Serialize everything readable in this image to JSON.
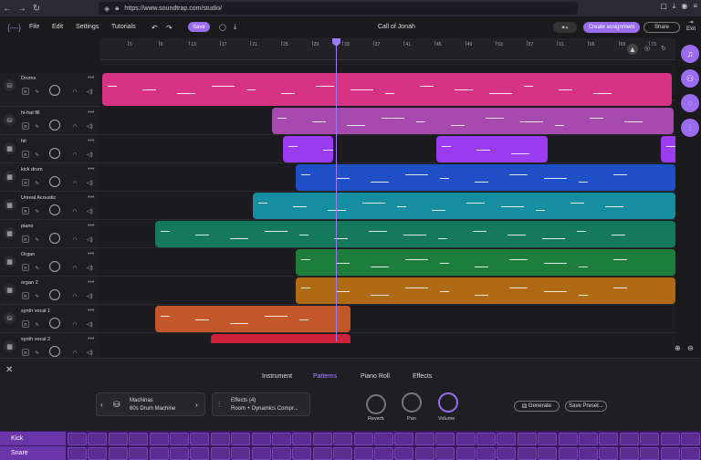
{
  "browser": {
    "url": "https://www.soundtrap.com/studio/"
  },
  "topbar": {
    "menu": [
      "File",
      "Edit",
      "Settings",
      "Tutorials"
    ],
    "save_label": "Save",
    "project_title": "Call of Jonah",
    "create_assignment": "Create assignment",
    "share": "Share",
    "exit": "Exit"
  },
  "ruler": {
    "ticks": [
      "5",
      "9",
      "13",
      "17",
      "21",
      "25",
      "29",
      "33",
      "37",
      "41",
      "45",
      "49",
      "53",
      "57",
      "61",
      "65",
      "69",
      "73"
    ]
  },
  "tracks": [
    {
      "name": "Drums",
      "icon": "drum-icon",
      "color": "#d63384"
    },
    {
      "name": "hi-hat fill",
      "icon": "drum-icon",
      "color": "#a64ab0"
    },
    {
      "name": "hit",
      "icon": "keyboard-icon",
      "color": "#9b3cf0"
    },
    {
      "name": "kick drum",
      "icon": "keyboard-icon",
      "color": "#1f4fc7"
    },
    {
      "name": "Unreal Acoustic",
      "icon": "keyboard-icon",
      "color": "#148ea0"
    },
    {
      "name": "piano",
      "icon": "keyboard-icon",
      "color": "#157a5c"
    },
    {
      "name": "Organ",
      "icon": "keyboard-icon",
      "color": "#1d7d3b"
    },
    {
      "name": "organ 2",
      "icon": "keyboard-icon",
      "color": "#b06a14"
    },
    {
      "name": "synth vocal 1",
      "icon": "drum-icon",
      "color": "#c4572a"
    },
    {
      "name": "synth vocal 2",
      "icon": "keyboard-icon",
      "color": "#d0213a"
    }
  ],
  "panel": {
    "tabs": [
      "Instrument",
      "Patterns",
      "Piano Roll",
      "Effects"
    ],
    "active_tab": "Patterns",
    "instrument_name": "Machinas",
    "instrument_sub": "80s Drum Machine",
    "effects_title": "Effects (4)",
    "effects_sub": "Room + Dynamics Compr...",
    "dials": [
      "Reverb",
      "Pan",
      "Volume"
    ],
    "generate": "Generate",
    "save_preset": "Save Preset..."
  },
  "pattern_rows": [
    "Kick",
    "Snare"
  ],
  "colors": {
    "accent": "#9b6cf0"
  }
}
